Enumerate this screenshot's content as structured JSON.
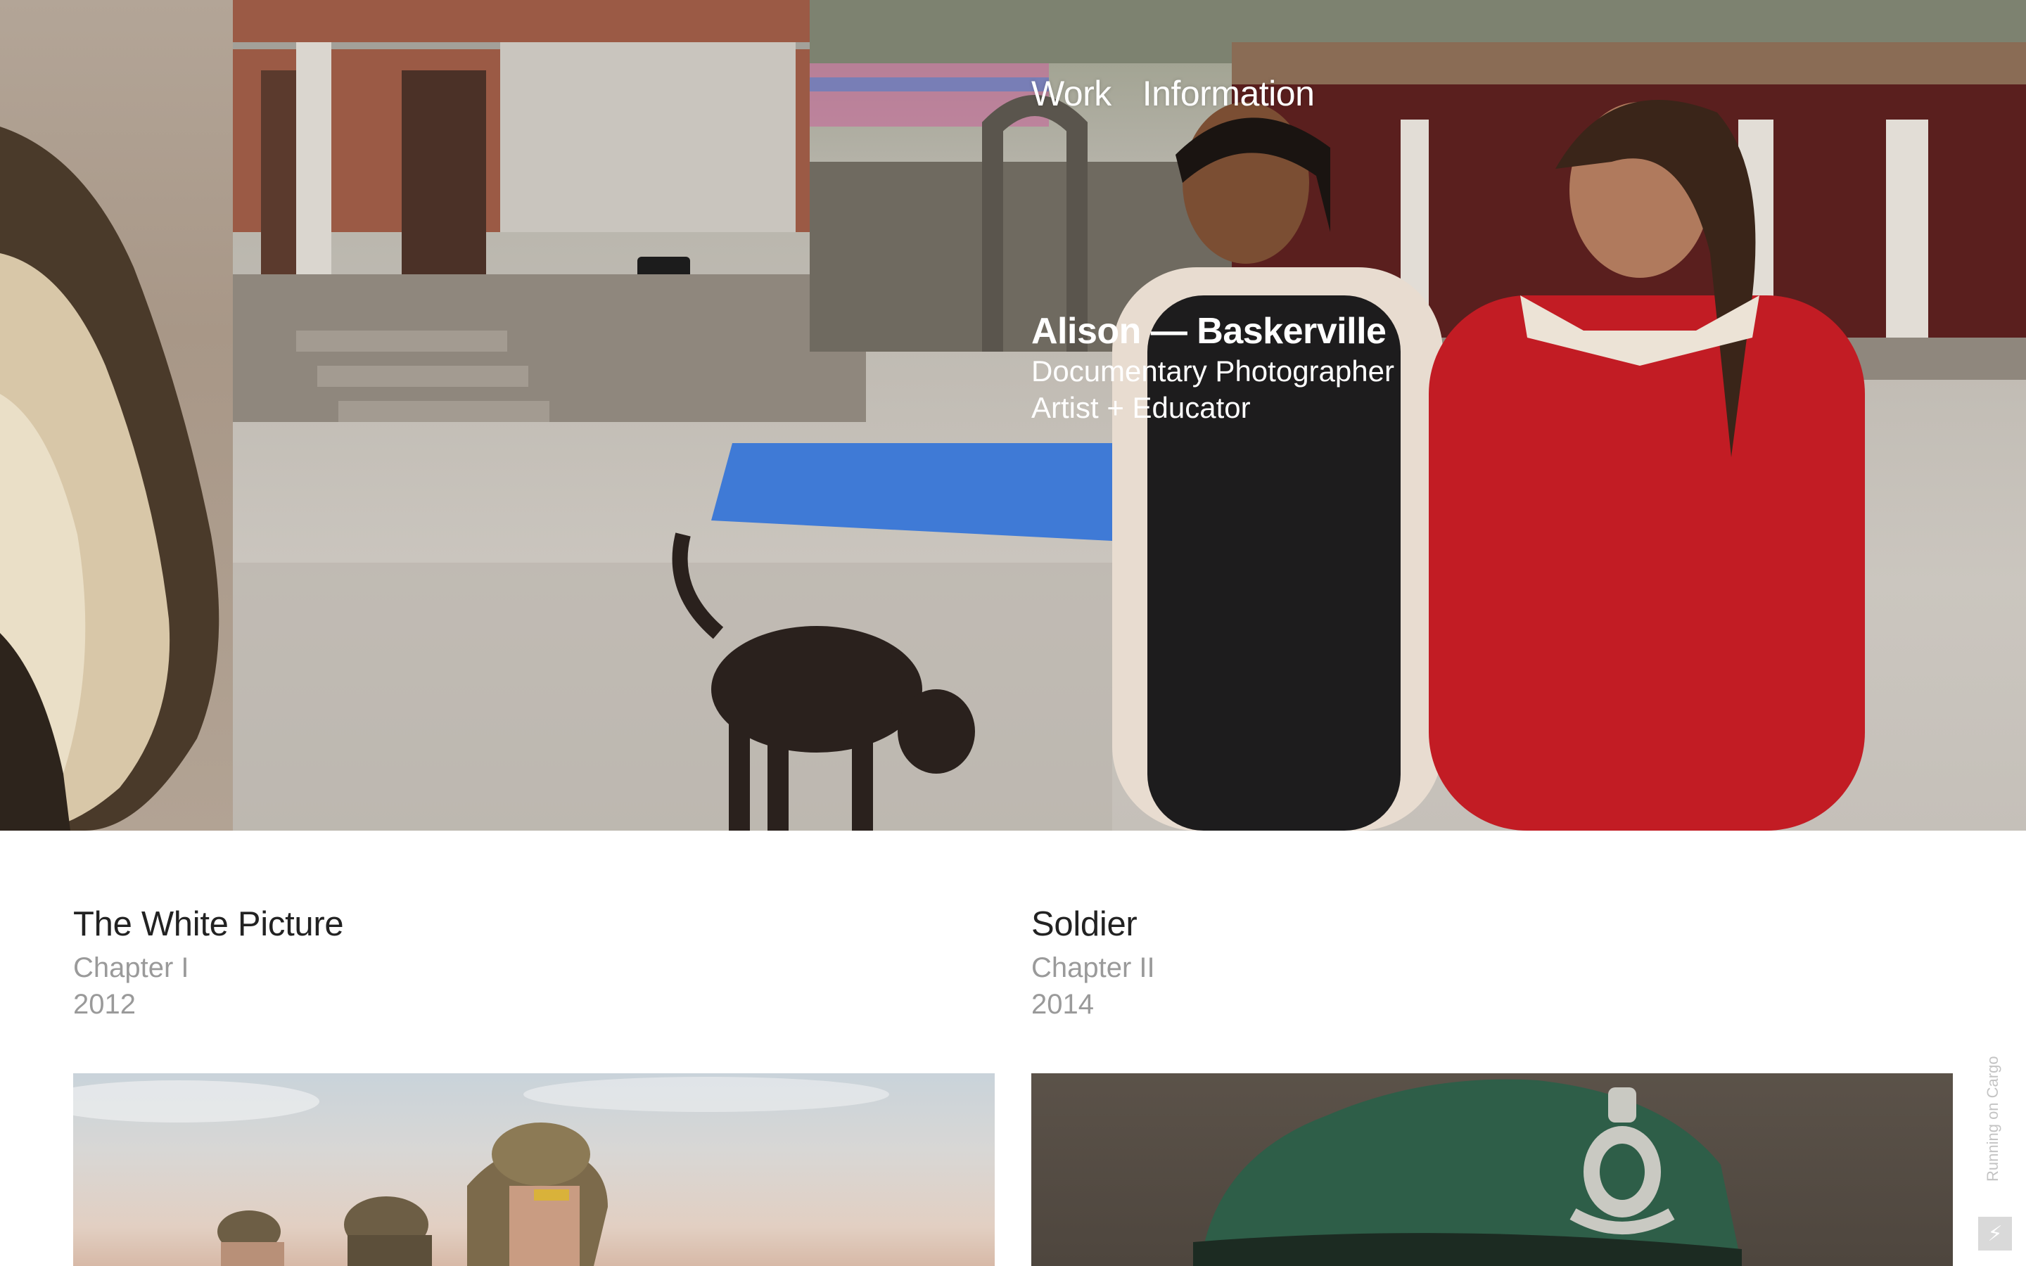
{
  "nav": {
    "work": "Work",
    "information": "Information"
  },
  "identity": {
    "name": "Alison — Baskerville",
    "line1": "Documentary Photographer",
    "line2": "Artist + Educator"
  },
  "projects": [
    {
      "title": "The White Picture",
      "chapter": "Chapter I",
      "year": "2012"
    },
    {
      "title": "Soldier",
      "chapter": "Chapter II",
      "year": "2014"
    }
  ],
  "footer": {
    "cargo_label": "Running on Cargo",
    "cargo_icon": "lightning-icon"
  },
  "colors": {
    "text_primary": "#222222",
    "text_secondary": "#9a9a9a",
    "overlay_text": "#ffffff"
  }
}
